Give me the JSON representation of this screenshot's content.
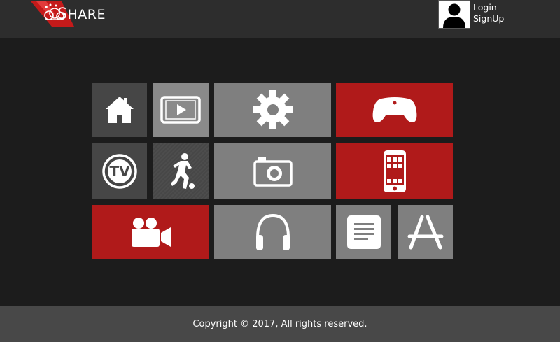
{
  "header": {
    "brand_first": "S",
    "brand_rest": "HARE",
    "login_label": "Login",
    "signup_label": "SignUp"
  },
  "tiles": [
    {
      "icon": "home-icon",
      "color": "#464646"
    },
    {
      "icon": "video-player-icon",
      "color": "#8a8a8a"
    },
    {
      "icon": "gear-icon",
      "color": "#7f7f7f"
    },
    {
      "icon": "gamepad-icon",
      "color": "#b01a1a"
    },
    {
      "icon": "tv-icon",
      "color": "#464646"
    },
    {
      "icon": "soccer-player-icon",
      "color": "#474747"
    },
    {
      "icon": "camera-icon",
      "color": "#7f7f7f"
    },
    {
      "icon": "smartphone-icon",
      "color": "#b01a1a"
    },
    {
      "icon": "movie-camera-icon",
      "color": "#b01a1a"
    },
    {
      "icon": "headphones-icon",
      "color": "#7f7f7f"
    },
    {
      "icon": "document-icon",
      "color": "#7f7f7f"
    },
    {
      "icon": "app-store-icon",
      "color": "#7f7f7f"
    }
  ],
  "footer": {
    "copyright": "Copyright © 2017, All rights reserved."
  },
  "colors": {
    "background": "#1c1c1c",
    "header": "#2d2d2d",
    "footer": "#484848",
    "accent_red": "#b01a1a"
  }
}
